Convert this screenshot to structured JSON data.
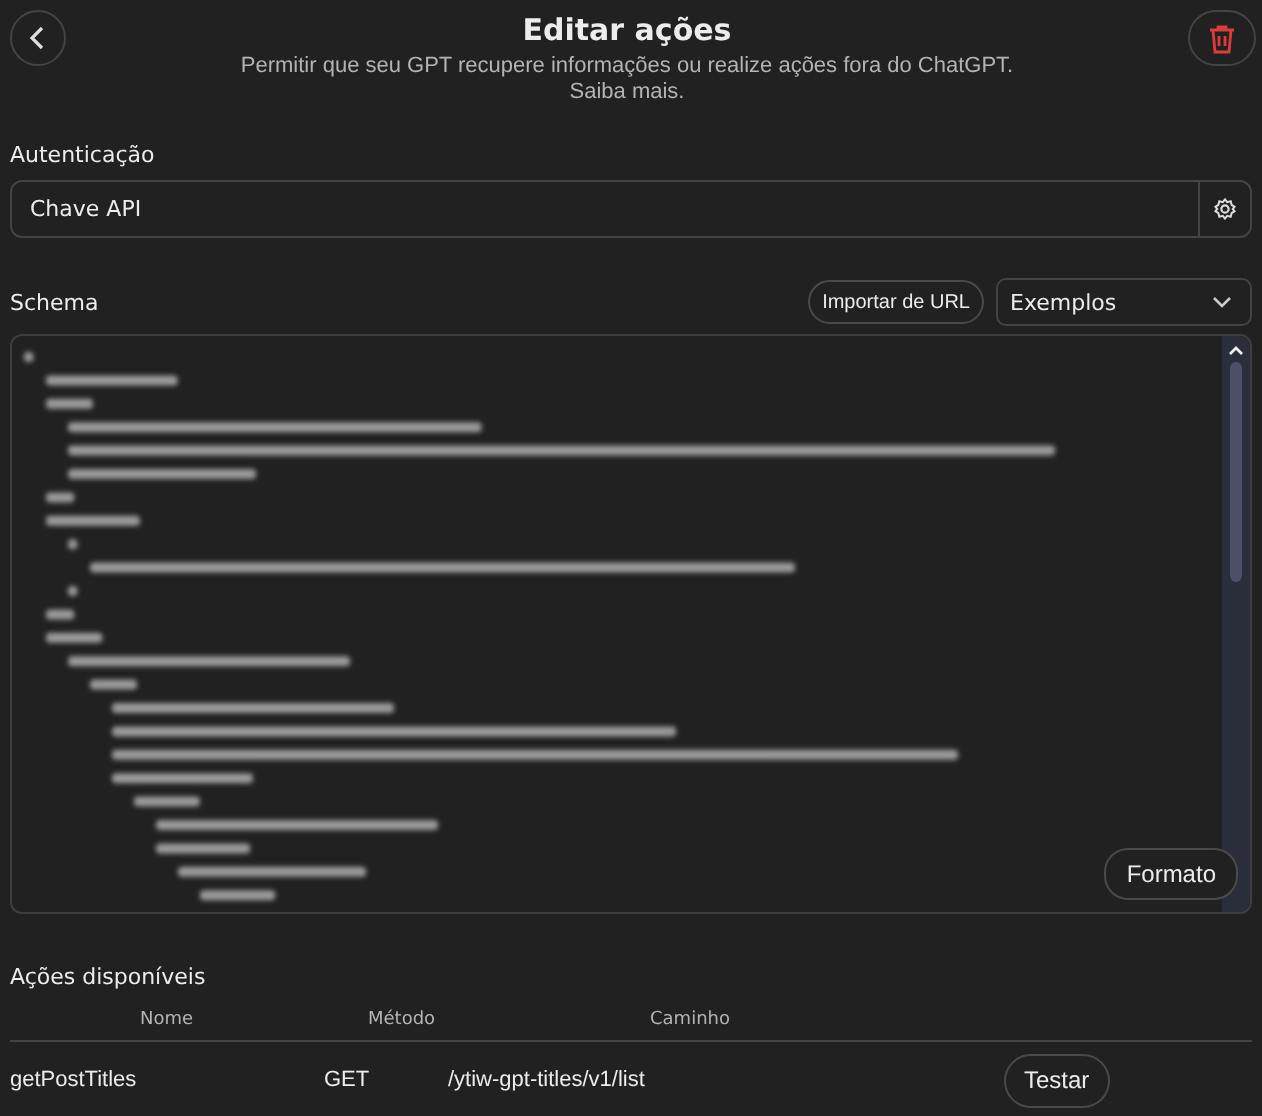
{
  "header": {
    "title": "Editar ações",
    "subtitle": "Permitir que seu GPT recupere informações ou realize ações fora do ChatGPT.",
    "link": "Saiba mais."
  },
  "authentication": {
    "label": "Autenticação",
    "value": "Chave API"
  },
  "schema": {
    "label": "Schema",
    "import_button": "Importar de URL",
    "examples_dropdown": "Exemplos",
    "format_button": "Formato"
  },
  "actions": {
    "title": "Ações disponíveis",
    "columns": [
      "Nome",
      "Método",
      "Caminho"
    ],
    "rows": [
      {
        "name": "getPostTitles",
        "method": "GET",
        "path": "/ytiw-gpt-titles/v1/list",
        "button": "Testar"
      }
    ]
  }
}
